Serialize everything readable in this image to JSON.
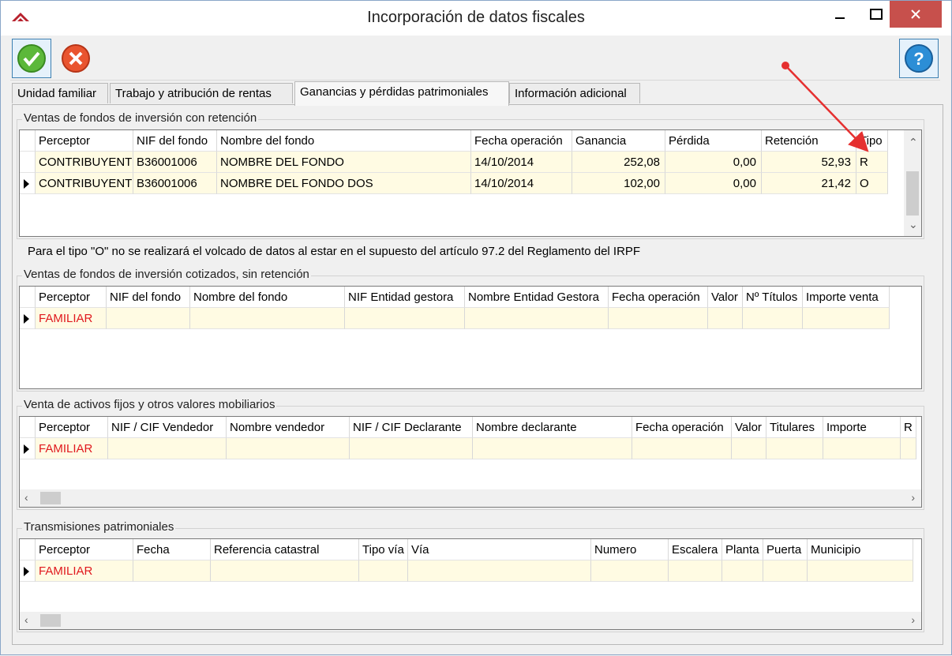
{
  "window": {
    "title": "Incorporación de datos fiscales"
  },
  "toolbar": {
    "accept": "accept-icon",
    "cancel": "cancel-icon",
    "help": "help-icon"
  },
  "tabs": [
    {
      "label": "Unidad familiar"
    },
    {
      "label": "Trabajo y atribución de rentas"
    },
    {
      "label": "Ganancias y pérdidas patrimoniales"
    },
    {
      "label": "Información adicional"
    }
  ],
  "section1": {
    "legend": "Ventas de fondos de inversión con retención",
    "headers": [
      "Perceptor",
      "NIF del fondo",
      "Nombre del fondo",
      "Fecha operación",
      "Ganancia",
      "Pérdida",
      "Retención",
      "Tipo"
    ],
    "rows": [
      [
        "CONTRIBUYENTE",
        "B36001006",
        "NOMBRE DEL FONDO",
        "14/10/2014",
        "252,08",
        "0,00",
        "52,93",
        "R"
      ],
      [
        "CONTRIBUYENTE",
        "B36001006",
        "NOMBRE DEL FONDO DOS",
        "14/10/2014",
        "102,00",
        "0,00",
        "21,42",
        "O"
      ]
    ]
  },
  "note": "Para el tipo \"O\" no se realizará el volcado de datos al estar en el supuesto del artículo 97.2 del Reglamento del IRPF",
  "section2": {
    "legend": "Ventas de fondos de inversión cotizados, sin retención",
    "headers": [
      "Perceptor",
      "NIF del fondo",
      "Nombre del fondo",
      "NIF Entidad gestora",
      "Nombre Entidad Gestora",
      "Fecha operación",
      "Valor",
      "Nº Títulos",
      "Importe venta"
    ],
    "rows": [
      [
        "FAMILIAR",
        "",
        "",
        "",
        "",
        "",
        "",
        "",
        ""
      ]
    ]
  },
  "section3": {
    "legend": "Venta de activos fijos y otros valores mobiliarios",
    "headers": [
      "Perceptor",
      "NIF / CIF Vendedor",
      "Nombre vendedor",
      "NIF / CIF Declarante",
      "Nombre declarante",
      "Fecha operación",
      "Valor",
      "Titulares",
      "Importe",
      "R"
    ],
    "rows": [
      [
        "FAMILIAR",
        "",
        "",
        "",
        "",
        "",
        "",
        "",
        "",
        ""
      ]
    ]
  },
  "section4": {
    "legend": "Transmisiones patrimoniales",
    "headers": [
      "Perceptor",
      "Fecha",
      "Referencia catastral",
      "Tipo vía",
      "Vía",
      "Numero",
      "Escalera",
      "Planta",
      "Puerta",
      "Municipio"
    ],
    "rows": [
      [
        "FAMILIAR",
        "",
        "",
        "",
        "",
        "",
        "",
        "",
        "",
        ""
      ]
    ]
  }
}
